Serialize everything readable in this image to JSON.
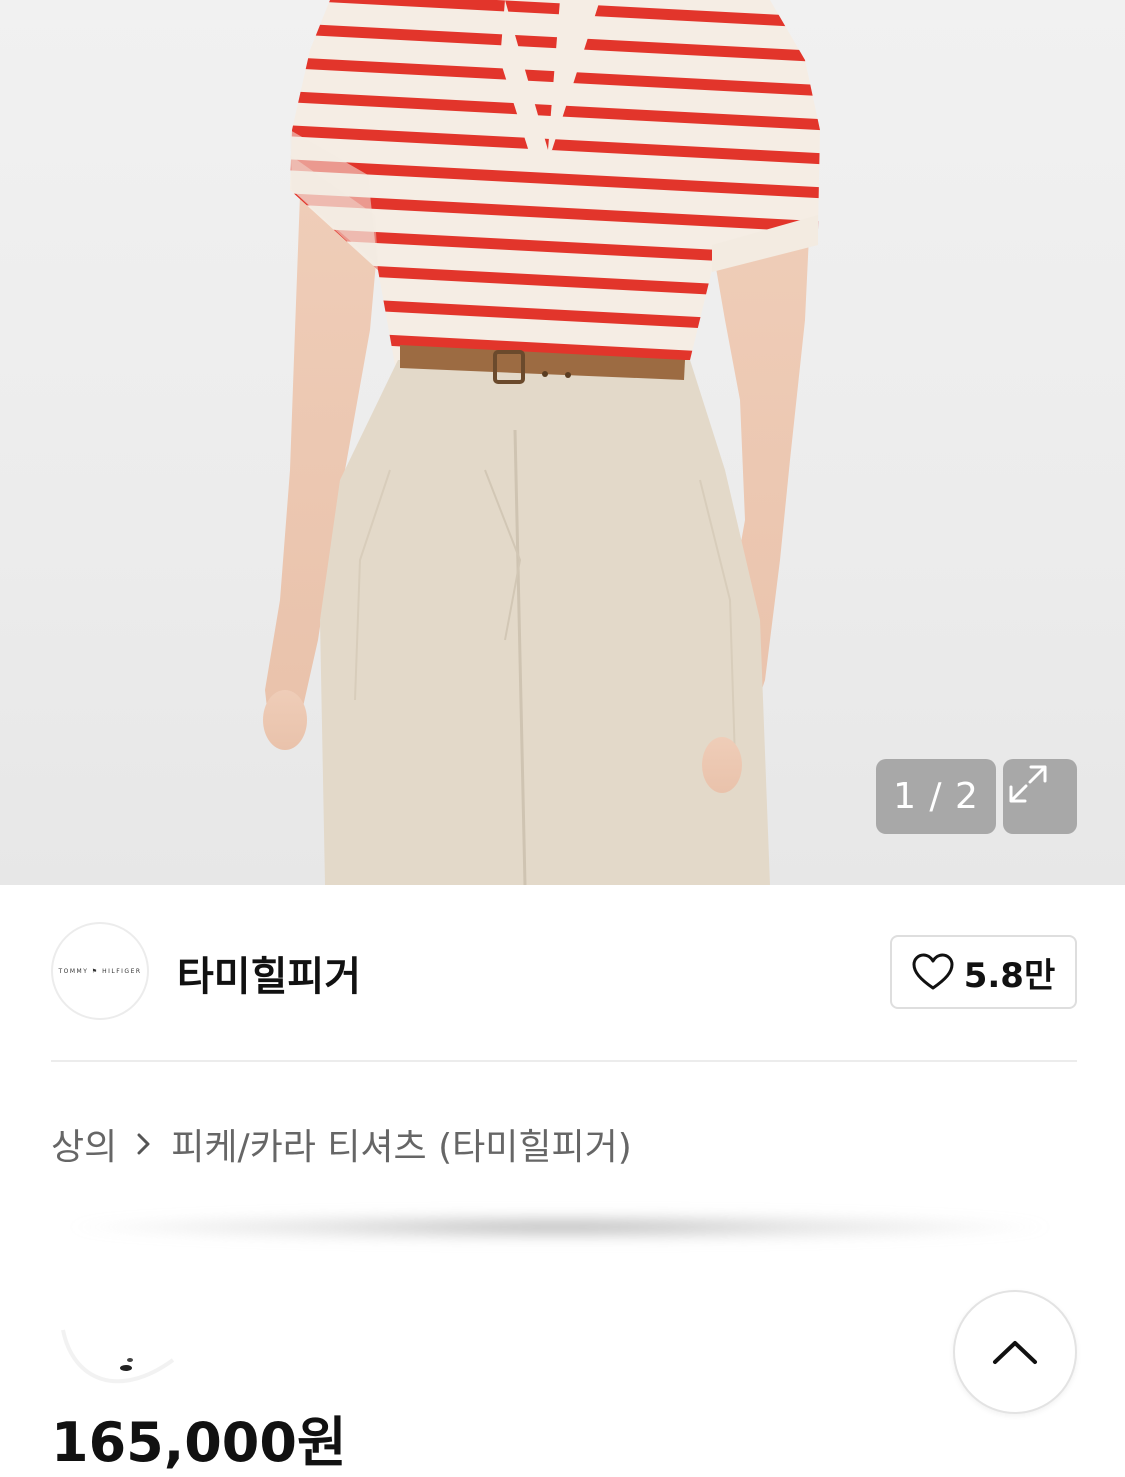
{
  "gallery": {
    "counter": "1 / 2",
    "expand_icon": "expand-arrows-icon"
  },
  "brand": {
    "logo_text": "TOMMY ⚑ HILFIGER",
    "name": "타미힐피거",
    "likes": "5.8만",
    "like_icon": "heart-outline-icon"
  },
  "breadcrumb": {
    "category": "상의",
    "subcategory": "피케/카라 티셔츠 (타미힐피거)"
  },
  "price": "165,000원",
  "colors": {
    "stripe_red": "#e2352b",
    "pants_beige": "#e3d9c9",
    "belt_brown": "#9c6b42"
  }
}
